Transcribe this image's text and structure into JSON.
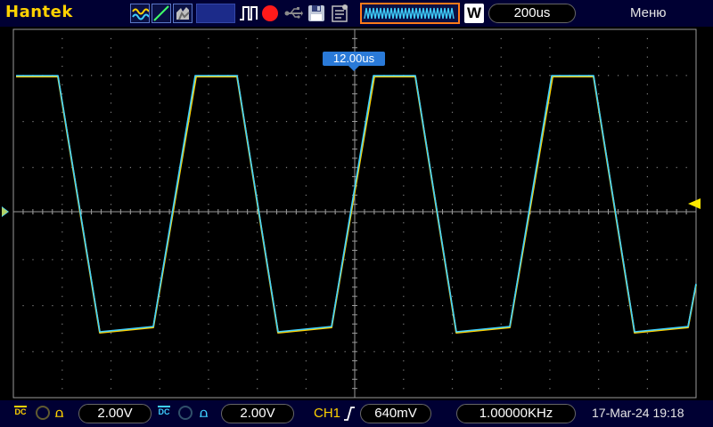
{
  "brand": "Hantek",
  "toolbar": {
    "icons": [
      "acquire-mode-icon",
      "trigger-mode-icon",
      "display-mode-icon",
      "pulse-icon",
      "record-icon",
      "usb-icon",
      "save-icon",
      "config-icon"
    ],
    "mode_badge": "W",
    "timebase": "200us",
    "menu_label": "Меню"
  },
  "screen": {
    "trigger_position": "12.00us"
  },
  "channels": {
    "ch1": {
      "coupling": "DC",
      "volts_div": "2.00V",
      "color": "#ffd200"
    },
    "ch2": {
      "coupling": "DC",
      "volts_div": "2.00V",
      "color": "#3fd0ff"
    }
  },
  "trigger": {
    "source": "CH1",
    "level": "640mV"
  },
  "frequency": "1.00000KHz",
  "datetime": "17-Mar-24 19:18",
  "colors": {
    "background": "#000000",
    "bar": "#000033",
    "accent": "#2a7ad8",
    "ch1": "#ffd200",
    "ch2": "#3fd0ff"
  }
}
